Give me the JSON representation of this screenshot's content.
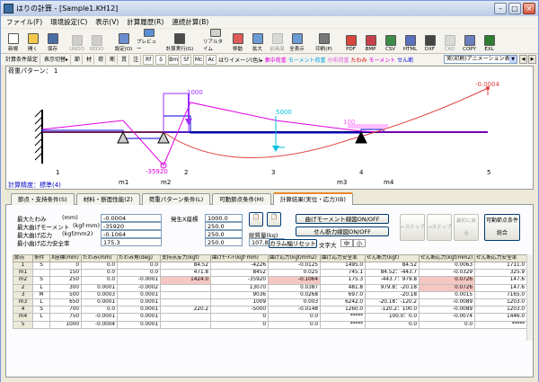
{
  "window": {
    "title": "はりの計算 - [Sample1.KH12]"
  },
  "menu": [
    "ファイル(F)",
    "環境設定(C)",
    "表示(V)",
    "計算履歴(R)",
    "連続計算(B)"
  ],
  "toolbar": [
    {
      "label": "新規",
      "icon": "new-file-icon",
      "color": "#ffffff",
      "enabled": true
    },
    {
      "label": "開く",
      "icon": "open-folder-icon",
      "color": "#f2c94c",
      "enabled": true
    },
    {
      "label": "保存",
      "icon": "save-icon",
      "color": "#4a6fa5",
      "enabled": true
    },
    {
      "label": "UNDO",
      "icon": "undo-icon",
      "color": "#888888",
      "enabled": false
    },
    {
      "label": "REDO",
      "icon": "redo-icon",
      "color": "#888888",
      "enabled": false
    },
    {
      "label": "設定(O)",
      "icon": "settings-icon",
      "color": "#6a8fcf",
      "enabled": true
    },
    {
      "label": "プレビュー",
      "icon": "preview-icon",
      "color": "#5b8fd8",
      "enabled": true
    },
    {
      "label": "計算実行(G)",
      "icon": "calculate-icon",
      "color": "#4c4c4c",
      "enabled": true
    },
    {
      "label": "リアルタイム",
      "icon": "realtime-icon",
      "color": "#d0d0d0",
      "enabled": true
    },
    {
      "label": "移動",
      "icon": "move-icon",
      "color": "#e05a5a",
      "enabled": true
    },
    {
      "label": "拡大",
      "icon": "zoom-in-icon",
      "color": "#6b9bd2",
      "enabled": true
    },
    {
      "label": "前画面",
      "icon": "previous-view-icon",
      "color": "#aaaaaa",
      "enabled": false
    },
    {
      "label": "全表示",
      "icon": "fit-all-icon",
      "color": "#6b9bd2",
      "enabled": true
    },
    {
      "label": "印刷(P)",
      "icon": "print-icon",
      "color": "#777777",
      "enabled": true
    },
    {
      "label": "PDF",
      "icon": "pdf-icon",
      "color": "#d9453b",
      "enabled": true
    },
    {
      "label": "BMP",
      "icon": "bmp-icon",
      "color": "#c6404a",
      "enabled": true
    },
    {
      "label": "CSV",
      "icon": "csv-icon",
      "color": "#3c8c4a",
      "enabled": true
    },
    {
      "label": "HTML",
      "icon": "html-icon",
      "color": "#5b6fbf",
      "enabled": true
    },
    {
      "label": "DXF",
      "icon": "dxf-icon",
      "color": "#444444",
      "enabled": true
    },
    {
      "label": "CAD",
      "icon": "cad-icon",
      "color": "#aaaaaa",
      "enabled": false
    },
    {
      "label": "COPY",
      "icon": "copy-icon",
      "color": "#6b7fbf",
      "enabled": true
    },
    {
      "label": "EXL",
      "icon": "excel-icon",
      "color": "#2e7d32",
      "enabled": true
    }
  ],
  "toolbar2": {
    "items": [
      "計算条件設定",
      "表示切替▸",
      "節",
      "材",
      "荷",
      "断",
      "質",
      "注"
    ],
    "small": [
      "Rf",
      "δ",
      "Bm",
      "Sf",
      "Mc",
      "Ac"
    ],
    "colored": [
      {
        "label": "はりイメージ(色)▸",
        "color": "#000000"
      },
      {
        "label": "集中荷重",
        "color": "#e000e0"
      },
      {
        "label": "モーメント荷重",
        "color": "#00a0e0"
      },
      {
        "label": "分布荷重",
        "color": "#e060e0"
      },
      {
        "label": "たわみ",
        "color": "#e00000"
      },
      {
        "label": "モーメント",
        "color": "#e000e0"
      },
      {
        "label": "せん断",
        "color": "#0000e0"
      }
    ],
    "combo": "実(印刷)アニメーション表示"
  },
  "canvas": {
    "pattern_label": "荷重パターン： 1",
    "accuracy_label": "計算精度：標準(4)",
    "node_labels": [
      "1",
      "m1",
      "m2",
      "2",
      "3",
      "m3",
      "4",
      "m4",
      "5"
    ],
    "value_labels": {
      "load1": "1000",
      "load2": "5000",
      "load3": "100",
      "moment": "-35920",
      "deflection": "-0.0004"
    }
  },
  "tabs": [
    {
      "label": "節点・支持条件(S)",
      "active": false
    },
    {
      "label": "材料・断面性能(Z)",
      "active": false
    },
    {
      "label": "荷重パターン条件(L)",
      "active": false
    },
    {
      "label": "可動節点条件(M)",
      "active": false
    },
    {
      "label": "計算結果(実位・応力)(B)",
      "active": true
    }
  ],
  "results": {
    "max_deflection": {
      "label": "最大たわみ",
      "unit": "(mm)",
      "value": "-0.0004"
    },
    "max_moment": {
      "label": "最大曲げモーメント",
      "unit": "(kgf·mm)",
      "value": "-35920"
    },
    "max_stress": {
      "label": "最大曲げ応力",
      "unit": "(kgf/mm2)",
      "value": "-0.1064"
    },
    "max_safety": {
      "label": "最小曲げ応力安全率",
      "unit": "",
      "value": "175.3"
    },
    "x_coord_label": "発生X座標",
    "x_coords": [
      "1000.0",
      "250.0",
      "250.0",
      "250.0"
    ],
    "total_weight_label": "総質量(kg)",
    "total_weight": "107.8"
  },
  "buttons": {
    "moment_line": "曲げモーメント線図ON/OFF",
    "shear_line": "せん断力線図ON/OFF",
    "column_reset": "カラム幅リセット",
    "font_size": "文字大",
    "font_mid": "中",
    "font_small": "小",
    "step_back": "←ステップ",
    "step_fwd": "→ステップ",
    "to_first": "最初に戻る",
    "movable_node": "可動節点条件統合"
  },
  "grid": {
    "headers": [
      "節点",
      "条件",
      "X座標(mm)",
      "たわみ(mm)",
      "たわみ角(deg)",
      "支持点反力(kgf)",
      "曲げﾓｰﾒﾝﾄ(kgf·mm)",
      "曲げ応力(kgf/mm2)",
      "曲げ応力安全率",
      "せん断力(kgf)",
      "せん断応力(kgf/mm2)",
      "せん断応力安全率"
    ],
    "rows": [
      {
        "cells": [
          "1",
          "S",
          "0",
          "0.0",
          "0.0",
          "84.52",
          "-4226",
          "-0.0125",
          "1495.0",
          "84.52",
          "0.0063",
          "1711.0"
        ],
        "hl": []
      },
      {
        "cells": [
          "m1",
          "",
          "150",
          "0.0",
          "0.0",
          "471.8",
          "8452",
          "0.025",
          "745.1",
          "84.52：-443.7",
          "-0.0329",
          "325.9"
        ],
        "hl": []
      },
      {
        "cells": [
          "m2",
          "S",
          "250",
          "0.0",
          "-0.0001",
          "1424.0",
          "-35920",
          "-0.1064",
          "175.3",
          "-443.7：979.8",
          "0.0726",
          "147.6"
        ],
        "hl": [
          5,
          7,
          10
        ]
      },
      {
        "cells": [
          "2",
          "L",
          "300",
          "0.0001",
          "-0.0002",
          "",
          "13070",
          "0.0387",
          "481.8",
          "979.8：-20.18",
          "0.0726",
          "147.6"
        ],
        "hl": [
          10
        ]
      },
      {
        "cells": [
          "3",
          "M",
          "500",
          "0.0003",
          "0.0001",
          "",
          "9036",
          "0.0268",
          "697.0",
          "-20.18",
          "0.0015",
          "7165.0"
        ],
        "hl": []
      },
      {
        "cells": [
          "m3",
          "L",
          "650",
          "0.0001",
          "0.0001",
          "",
          "1009",
          "0.003",
          "6242.0",
          "-20.18：-120.2",
          "-0.0089",
          "1203.0"
        ],
        "hl": []
      },
      {
        "cells": [
          "4",
          "S",
          "700",
          "0.0",
          "0.0001",
          "220.2",
          "-5000",
          "-0.0148",
          "1260.0",
          "-120.2：100.0",
          "-0.0089",
          "1203.0"
        ],
        "hl": []
      },
      {
        "cells": [
          "m4",
          "L",
          "750",
          "-0.0001",
          "0.0001",
          "",
          "0",
          "0.0",
          "*****",
          "100.0：0.0",
          "-0.0074",
          "1446.0"
        ],
        "hl": []
      },
      {
        "cells": [
          "5",
          "",
          "1000",
          "-0.0004",
          "0.0001",
          "",
          "0",
          "0.0",
          "*****",
          "0.0",
          "0.0",
          "*****"
        ],
        "hl": []
      }
    ]
  }
}
